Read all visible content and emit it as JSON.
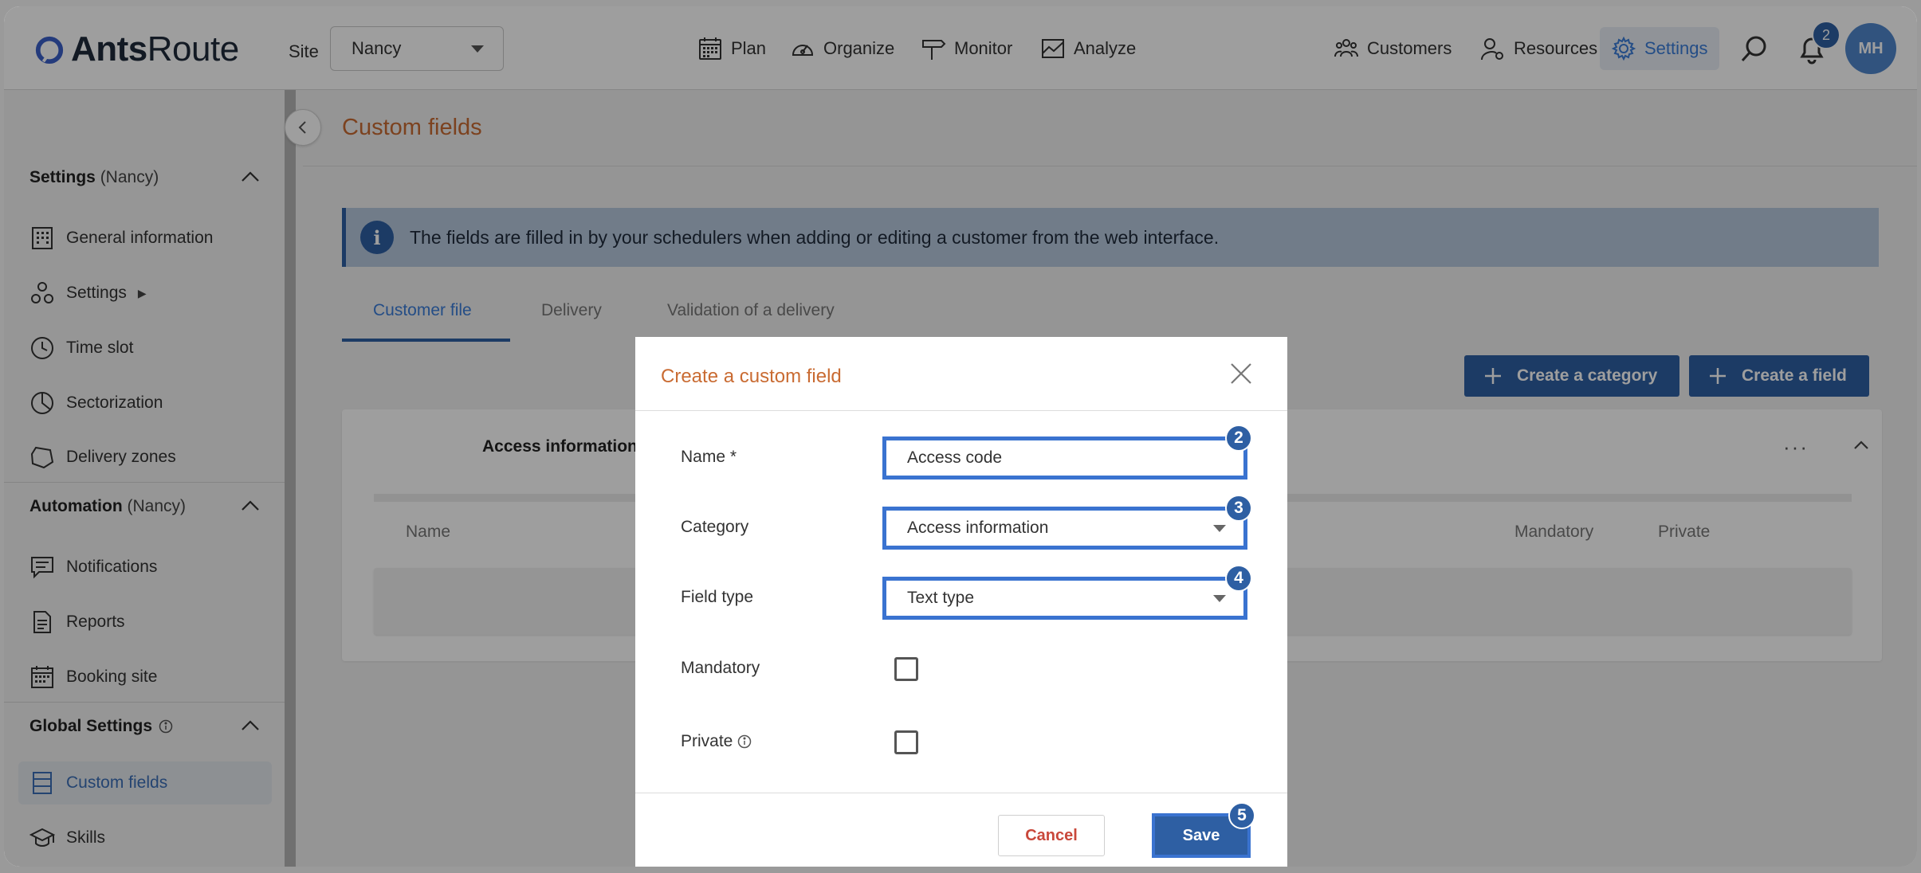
{
  "app": {
    "logo_bold": "Ants",
    "logo_light": "Route",
    "site_label": "Site",
    "site_value": "Nancy",
    "accent_color": "#2e5fa3",
    "title_color": "#c96b32"
  },
  "nav": {
    "plan": "Plan",
    "organize": "Organize",
    "monitor": "Monitor",
    "analyze": "Analyze",
    "customers": "Customers",
    "resources": "Resources",
    "settings": "Settings",
    "notification_count": "2",
    "avatar_initials": "MH"
  },
  "sidebar": {
    "section_settings": "Settings",
    "section_settings_site": "(Nancy)",
    "general_information": "General information",
    "settings": "Settings",
    "settings_arrow": "▶",
    "time_slot": "Time slot",
    "sectorization": "Sectorization",
    "delivery_zones": "Delivery zones",
    "section_automation": "Automation",
    "section_automation_site": "(Nancy)",
    "notifications": "Notifications",
    "reports": "Reports",
    "booking_site": "Booking site",
    "section_global": "Global Settings",
    "custom_fields": "Custom fields",
    "skills": "Skills"
  },
  "page": {
    "title": "Custom fields",
    "info": "The fields are filled in by your schedulers when adding or editing a customer from the web interface.",
    "tabs": [
      "Customer file",
      "Delivery",
      "Validation of a delivery"
    ],
    "create_category": "Create a category",
    "create_field": "Create a field",
    "card_title": "Access information",
    "card_menu": "···",
    "columns": [
      "Name",
      "Mandatory",
      "Private"
    ]
  },
  "modal": {
    "title": "Create a custom field",
    "name_label": "Name *",
    "name_value": "Access code",
    "category_label": "Category",
    "category_value": "Access information",
    "type_label": "Field type",
    "type_value": "Text type",
    "mandatory_label": "Mandatory",
    "private_label": "Private",
    "cancel": "Cancel",
    "save": "Save",
    "steps": [
      "2",
      "3",
      "4",
      "5"
    ]
  }
}
